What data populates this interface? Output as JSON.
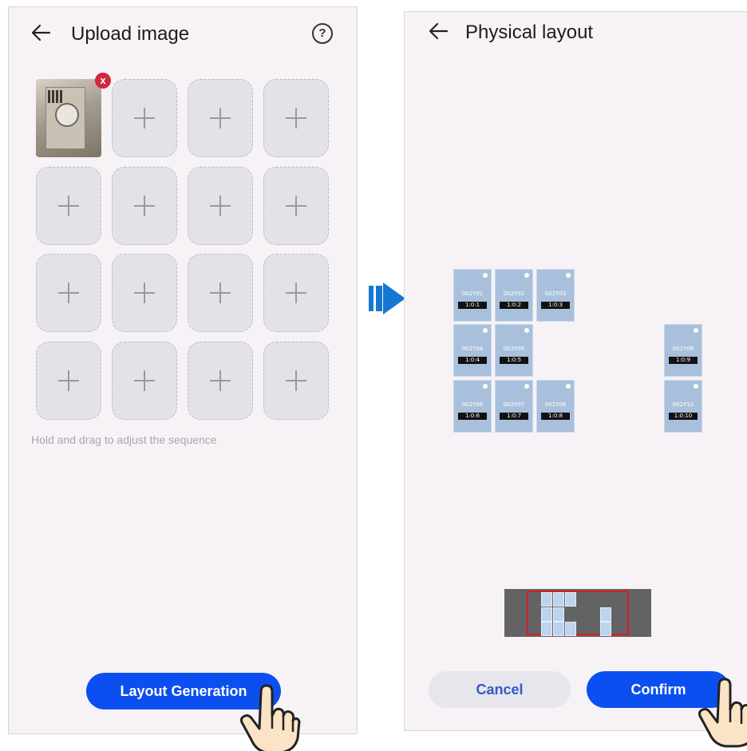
{
  "upload_screen": {
    "title": "Upload image",
    "help_icon": "?",
    "remove_icon": "x",
    "hint": "Hold and drag to adjust the sequence",
    "generate_button": "Layout Generation",
    "tile_count": 16,
    "filled_tiles": 1
  },
  "layout_screen": {
    "title": "Physical layout",
    "cancel_button": "Cancel",
    "confirm_button": "Confirm",
    "panels": [
      {
        "id": "002Y01",
        "pos": "1:0:1"
      },
      {
        "id": "002Y02",
        "pos": "1:0:2"
      },
      {
        "id": "002Y03",
        "pos": "1:0:3"
      },
      {
        "id": "002Y04",
        "pos": "1:0:4"
      },
      {
        "id": "002Y05",
        "pos": "1:0:5"
      },
      {
        "id": "002Y06",
        "pos": "1:0:6"
      },
      {
        "id": "002Y07",
        "pos": "1:0:7"
      },
      {
        "id": "002Y08",
        "pos": "1:0:8"
      },
      {
        "id": "002Y09",
        "pos": "1:0:9"
      },
      {
        "id": "002Y10",
        "pos": "1:0:10"
      }
    ]
  },
  "colors": {
    "accent": "#0c4ff0",
    "screen_bg": "#f6f2f6",
    "tile_bg": "#e4e2e9",
    "panel_bg": "#a9c0dc",
    "remove_badge": "#d7263d",
    "minimap_frame": "#e01b1b",
    "flow_arrow": "#1677d2"
  },
  "icons": {
    "back": "back-arrow-icon",
    "help": "help-circle-icon",
    "add": "plus-icon",
    "remove": "remove-badge-icon",
    "pointer": "tap-hand-icon",
    "flow": "next-step-arrow-icon"
  }
}
